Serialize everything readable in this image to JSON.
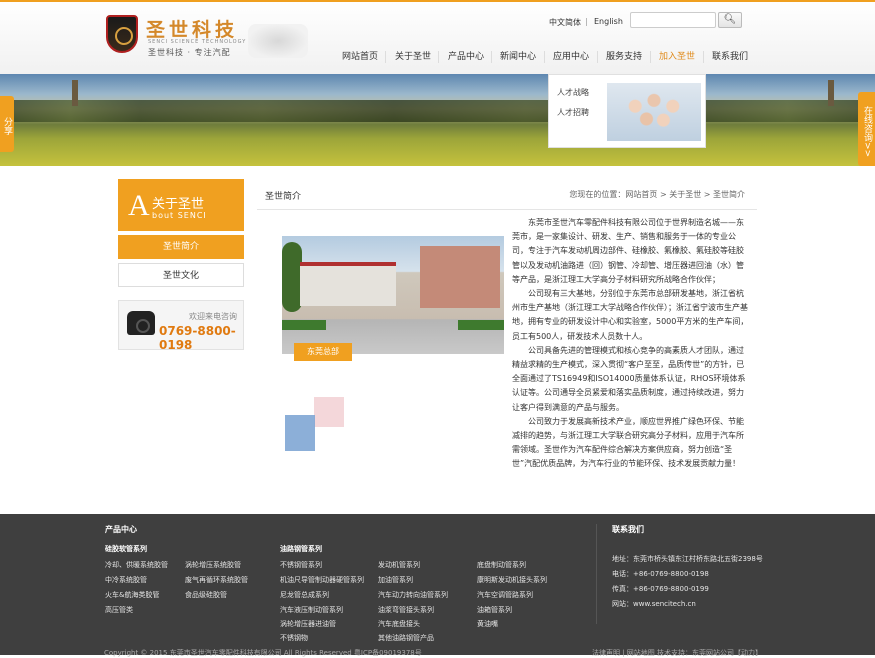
{
  "brand": {
    "name": "圣世科技",
    "en": "SENCI SCIENCE TECHNOLOGY",
    "slogan": "圣世科技 · 专注汽配"
  },
  "header": {
    "lang_cn": "中文简体",
    "lang_sep": "|",
    "lang_en": "English",
    "search_placeholder": "",
    "search_icon": "search-icon"
  },
  "nav": [
    "网站首页",
    "关于圣世",
    "产品中心",
    "新闻中心",
    "应用中心",
    "服务支持",
    "加入圣世",
    "联系我们"
  ],
  "nav_active_index": 6,
  "dropdown": [
    "人才战略",
    "人才招聘"
  ],
  "side": {
    "share": "分享",
    "online": "在线咨询>>"
  },
  "sidebar": {
    "title_letter": "A",
    "title_cn": "关于圣世",
    "title_en": "bout SENCI",
    "items": [
      "圣世简介",
      "圣世文化"
    ],
    "phone_label": "欢迎来电咨询",
    "phone": "0769-8800-0198"
  },
  "content": {
    "title": "圣世简介",
    "breadcrumb": "您现在的位置：网站首页 > 关于圣世 > 圣世简介",
    "photo_caption": "东莞总部",
    "paragraphs": [
      "东莞市圣世汽车零配件科技有限公司位于世界制造名城——东莞市，是一家集设计、研发、生产、销售和服务于一体的专业公司，专注于汽车发动机周边部件、硅橡胶、氟橡胶、氟硅胶等硅胶管以及发动机油路进（回）钢管、冷却管、增压器进回油（水）管等产品，是浙江理工大学高分子材料研究所战略合作伙伴；",
      "公司现有三大基地，分别位于东莞市总部研发基地，浙江省杭州市生产基地（浙江理工大学战略合作伙伴）；浙江省宁波市生产基地，拥有专业的研发设计中心和实验室，5000平方米的生产车间，员工有500人，研发技术人员数十人。",
      "公司具备先进的管理模式和核心竞争的高素质人才团队，通过精益求精的生产模式，深入贯彻“客户至至，品质传世”的方针，已全面通过了TS16949和ISO14000质量体系认证，RHOS环境体系认证等。公司通导全员紧爱和落实品质制度，通过持续改进，努力让客户得到满意的产品与服务。",
      "公司致力于发展高新技术产业，顺应世界推广绿色环保、节能减排的趋势，与浙江理工大学联合研究高分子材料，应用于汽车所需领域。圣世作为汽车配件综合解决方案供应商，努力创造“圣世”汽配优质品牌，为汽车行业的节能环保、技术发展贡献力量！"
    ]
  },
  "footer": {
    "products_heading": "产品中心",
    "col1_heading": "硅胶软管系列",
    "col1": [
      "冷却、供暖系统胶管",
      "中冷系统胶管",
      "火车&航海类胶管",
      "高压管类"
    ],
    "col2": [
      "涡轮增压系统胶管",
      "废气再循环系统胶管",
      "食品级硅胶管"
    ],
    "col3_heading": "油路钢管系列",
    "col3": [
      "不锈钢管系列",
      "机油尺导管制动器硬管系列",
      "尼龙管总成系列",
      "汽车液压制动管系列",
      "涡轮增压器进油管",
      "不锈钢物"
    ],
    "col4": [
      "发动机管系列",
      "加油管系列",
      "汽车动力转向油管系列",
      "油浆弯管接头系列",
      "汽车底盘接头",
      "其他油路钢管产品"
    ],
    "col5": [
      "底盘制动管系列",
      "康明斯发动机接头系列",
      "汽车空调管路系列",
      "油箱管系列",
      "黄油嘴"
    ],
    "contact_heading": "联系我们",
    "contact": [
      "地址：东莞市桥头镇东江村桥东路北五街2398号",
      "电话：+86-0769-8800-0198",
      "传真：+86-0769-8800-0199",
      "网站：www.sencitech.cn"
    ],
    "copyright": "Copyright © 2015 东莞市圣世汽车零配件科技有限公司 All Rights Reserved 粤ICP备09019378号",
    "copyright_right": "法律声明 | 网站地图 技术支持：东莞网站公司【动力】"
  }
}
